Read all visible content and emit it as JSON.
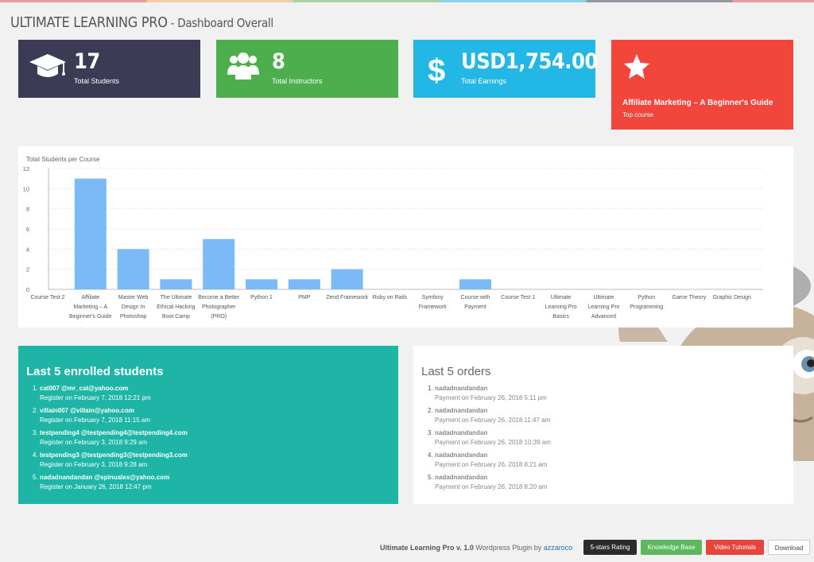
{
  "header": {
    "title": "ULTIMATE LEARNING PRO",
    "separator": " - ",
    "subtitle": "Dashboard Overall"
  },
  "stats": {
    "students": {
      "value": "17",
      "label": "Total Students",
      "icon": "graduation-cap-icon"
    },
    "instructors": {
      "value": "8",
      "label": "Total Instructors",
      "icon": "users-icon"
    },
    "earnings": {
      "value": "USD1,754.00",
      "label": "Total Earnings",
      "icon": "dollar-icon"
    },
    "top_course": {
      "course": "Affiliate Marketing – A Beginner's Guide",
      "label": "Top course",
      "icon": "star-icon"
    }
  },
  "colors": {
    "students": "#3b3b55",
    "instructors": "#4cae4c",
    "earnings": "#23b7e5",
    "top_course": "#f2453b",
    "enrolled_panel": "#1fb5a6",
    "bar": "#7cb9f7"
  },
  "chart_data": {
    "type": "bar",
    "title": "Total Students per Course",
    "ylim": [
      0,
      12
    ],
    "yticks": [
      0,
      2,
      4,
      6,
      8,
      10,
      12
    ],
    "grid": true,
    "categories": [
      [
        "Course Test 2"
      ],
      [
        "Affiliate",
        "Marketing – A",
        "Beginner's Guide"
      ],
      [
        "Master Web",
        "Design In",
        "Photoshop"
      ],
      [
        "The Ultimate",
        "Ethical Hacking",
        "Boot Camp"
      ],
      [
        "Become a Better",
        "Photographer",
        "(PRO)"
      ],
      [
        "Python 1"
      ],
      [
        "PMP"
      ],
      [
        "Zend Framework"
      ],
      [
        "Ruby on Rails"
      ],
      [
        "Symfony",
        "Framework"
      ],
      [
        "Course with",
        "Payment"
      ],
      [
        "Course Test 1"
      ],
      [
        "Ultimate",
        "Learning Pro",
        "Basics"
      ],
      [
        "Ultimate",
        "Learning Pro",
        "Advanced"
      ],
      [
        "Python",
        "Programming"
      ],
      [
        "Game Theory"
      ],
      [
        "Graphic Design"
      ]
    ],
    "values": [
      0,
      11,
      4,
      1,
      5,
      1,
      1,
      2,
      0,
      0,
      1,
      0,
      0,
      0,
      0,
      0,
      0
    ]
  },
  "enrolled": {
    "title": "Last 5 enrolled students",
    "items": [
      {
        "num": "1.",
        "name": "cat007 @mr_cat@yahoo.com",
        "sub": "Register on February 7, 2018 12:21 pm"
      },
      {
        "num": "2.",
        "name": "villain007 @villain@yahoo.com",
        "sub": "Register on February 7, 2018 11:15 am"
      },
      {
        "num": "3.",
        "name": "testpending4 @testpending4@testpending4.com",
        "sub": "Register on February 3, 2018 9:29 am"
      },
      {
        "num": "4.",
        "name": "testpending3 @testpending3@testpending3.com",
        "sub": "Register on February 3, 2018 9:28 am"
      },
      {
        "num": "5.",
        "name": "nadadnandandan @spinualex@yahoo.com",
        "sub": "Register on January 26, 2018 12:47 pm"
      }
    ]
  },
  "orders": {
    "title": "Last 5 orders",
    "items": [
      {
        "num": "1.",
        "name": "nadadnandandan",
        "sub": "Payment on February 26, 2018 5:11 pm"
      },
      {
        "num": "2.",
        "name": "nadadnandandan",
        "sub": "Payment on February 26, 2018 11:47 am"
      },
      {
        "num": "3.",
        "name": "nadadnandandan",
        "sub": "Payment on February 26, 2018 10:39 am"
      },
      {
        "num": "4.",
        "name": "nadadnandandan",
        "sub": "Payment on February 26, 2018 8:21 am"
      },
      {
        "num": "5.",
        "name": "nadadnandandan",
        "sub": "Payment on February 26, 2018 8:20 am"
      }
    ]
  },
  "footer": {
    "brand": "Ultimate Learning Pro v. 1.0",
    "mid": " Wordpress Plugin by ",
    "author": "azzaroco",
    "buttons": {
      "rating": "5-stars Rating",
      "kb": "Knowledge Base",
      "video": "Video Tutorials",
      "download": "Download"
    }
  }
}
